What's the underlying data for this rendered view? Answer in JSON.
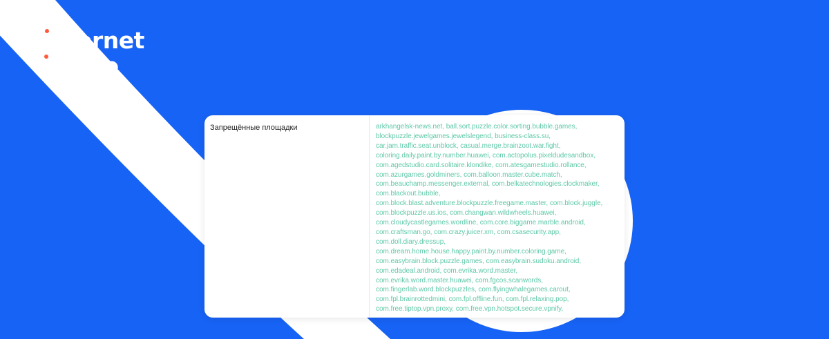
{
  "logo": {
    "line1": "internet",
    "line2": "active"
  },
  "colors": {
    "background": "#1763f5",
    "card": "#ffffff",
    "link_text": "#5ec8a8",
    "logo_dot": "#ff5a3c"
  },
  "setting": {
    "label": "Запрещённые площадки",
    "lines": [
      "arkhangelsk-news.net, ball.sort.puzzle.color.sorting.bubble.games,",
      "blockpuzzle.jewelgames.jewelslegend, business-class.su,",
      "car.jam.traffic.seat.unblock, casual.merge.brainzoot.war.fight,",
      "coloring.daily.paint.by.number.huawei, com.actopolus.pixeldudesandbox,",
      "com.agedstudio.card.solitaire.klondike, com.atesgamestudio.rollance,",
      "com.azurgames.goldminers, com.balloon.master.cube.match,",
      "com.beauchamp.messenger.external, com.belkatechnologies.clockmaker,",
      "com.blackout.bubble,",
      "com.block.blast.adventure.blockpuzzle.freegame.master, com.block.juggle,",
      "com.blockpuzzle.us.ios, com.changwan.wildwheels.huawei,",
      "com.cloudycastlegames.wordline, com.core.biggame.marble.android,",
      "com.craftsman.go, com.crazy.juicer.xm, com.csasecurity.app,",
      "com.doll.diary.dressup,",
      "com.dream.home.house.happy.paint.by.number.coloring.game,",
      "com.easybrain.block.puzzle.games, com.easybrain.sudoku.android,",
      "com.edadeal.android, com.evrika.word.master,",
      "com.evrika.word.master.huawei, com.fgcos.scanwords,",
      "com.fingerlab.word.blockpuzzles, com.flyingwhalegames.carout,",
      "com.fpl.brainrottedmini, com.fpl.offline.fun, com.fpl.relaxing.pop,",
      "com.free.tiptop.vpn.proxy, com.free.vpn.hotspot.secure.vpnify,"
    ]
  }
}
